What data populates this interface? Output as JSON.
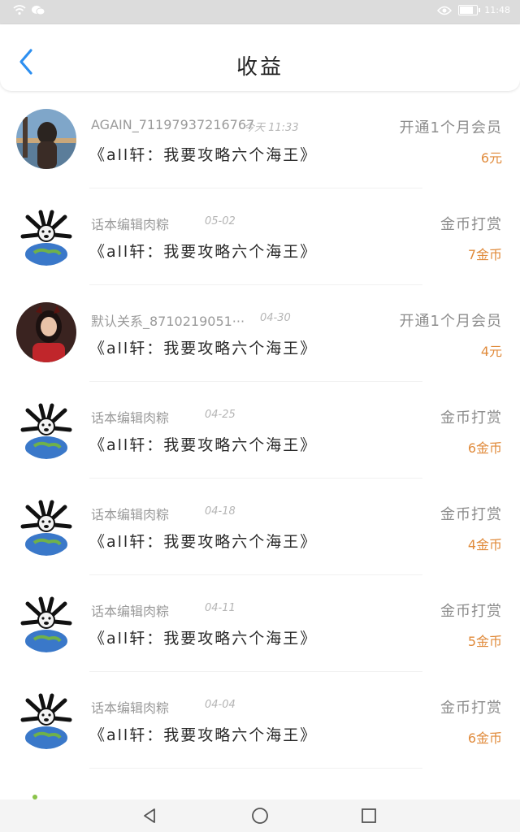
{
  "status_bar": {
    "time": "11:48",
    "icons": [
      "wifi-icon",
      "wechat-icon",
      "eye-icon",
      "battery-icon"
    ]
  },
  "header": {
    "title": "收益",
    "back_icon": "chevron-left-icon"
  },
  "colors": {
    "accent_blue": "#2d8ff0",
    "amount_orange": "#e08a3a"
  },
  "items": [
    {
      "name": "AGAIN_711979372167​67",
      "time": "今天 11:33",
      "book": "《all轩：我要攻略六个海王》",
      "type": "开通1个月会员",
      "amount": "6元",
      "avatar": "photo-woman-avatar"
    },
    {
      "name": "话本编辑肉粽",
      "time": "05-02",
      "book": "《all轩：我要攻略六个海王》",
      "type": "金币打赏",
      "amount": "7金币",
      "avatar": "meme-earth-avatar"
    },
    {
      "name": "默认关系_8710219051···",
      "time": "04-30",
      "book": "《all轩：我要攻略六个海王》",
      "type": "开通1个月会员",
      "amount": "4元",
      "avatar": "photo-girl-avatar"
    },
    {
      "name": "话本编辑肉粽",
      "time": "04-25",
      "book": "《all轩：我要攻略六个海王》",
      "type": "金币打赏",
      "amount": "6金币",
      "avatar": "meme-earth-avatar"
    },
    {
      "name": "话本编辑肉粽",
      "time": "04-18",
      "book": "《all轩：我要攻略六个海王》",
      "type": "金币打赏",
      "amount": "4金币",
      "avatar": "meme-earth-avatar"
    },
    {
      "name": "话本编辑肉粽",
      "time": "04-11",
      "book": "《all轩：我要攻略六个海王》",
      "type": "金币打赏",
      "amount": "5金币",
      "avatar": "meme-earth-avatar"
    },
    {
      "name": "话本编辑肉粽",
      "time": "04-04",
      "book": "《all轩：我要攻略六个海王》",
      "type": "金币打赏",
      "amount": "6金币",
      "avatar": "meme-earth-avatar"
    }
  ],
  "nav_bar": {
    "icons": [
      "back-triangle-icon",
      "home-circle-icon",
      "recent-square-icon"
    ]
  }
}
